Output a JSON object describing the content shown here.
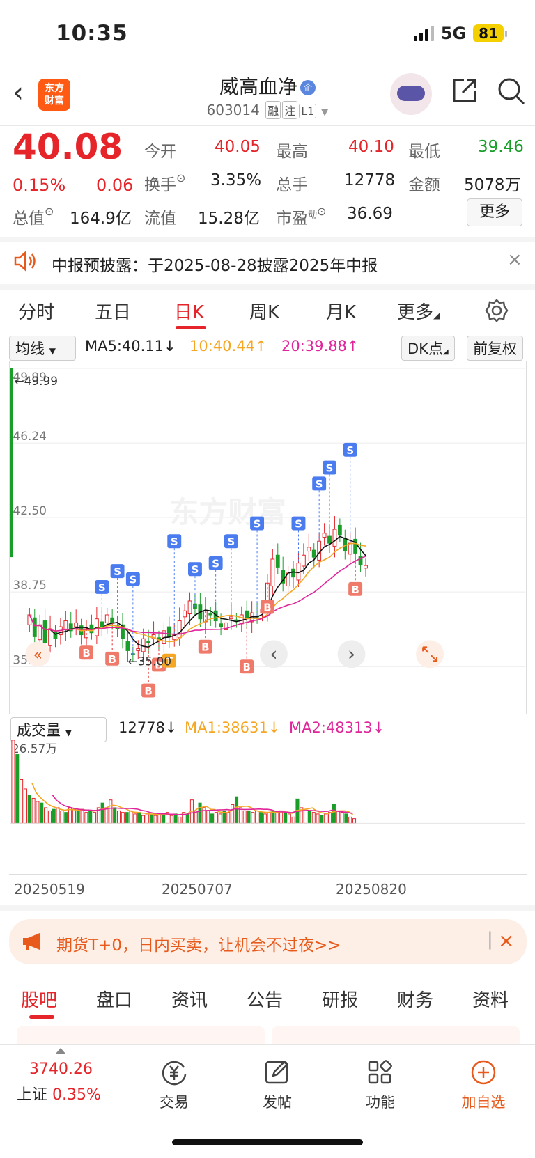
{
  "status": {
    "time": "10:35",
    "network": "5G",
    "battery": "81"
  },
  "header": {
    "logo_line1": "东方",
    "logo_line2": "财富",
    "stock_name": "威高血净",
    "name_badge": "企",
    "stock_code": "603014",
    "tags": [
      "融",
      "注",
      "L1"
    ]
  },
  "quote": {
    "price": "40.08",
    "change_pct": "0.15%",
    "change_amt": "0.06",
    "open_label": "今开",
    "open_value": "40.05",
    "high_label": "最高",
    "high_value": "40.10",
    "low_label": "最低",
    "low_value": "39.46",
    "turnover_label": "换手",
    "turnover_value": "3.35%",
    "total_hands_label": "总手",
    "total_hands_value": "12778",
    "amount_label": "金额",
    "amount_value": "5078万",
    "mktcap_label": "总值",
    "mktcap_value": "164.9亿",
    "float_label": "流值",
    "float_value": "15.28亿",
    "pe_label": "市盈",
    "pe_sup": "动",
    "pe_value": "36.69",
    "more_label": "更多"
  },
  "notice": {
    "text": "中报预披露：于2025-08-28披露2025年中报"
  },
  "chart_tabs": [
    "分时",
    "五日",
    "日K",
    "周K",
    "月K",
    "更多"
  ],
  "active_chart_tab": "日K",
  "ma_row": {
    "indicator": "均线",
    "ma5": "MA5:40.11↓",
    "ma10": "10:40.44↑",
    "ma20": "20:39.88↑",
    "dk_label": "DK点",
    "adjust_label": "前复权"
  },
  "chart_data": {
    "type": "candlestick",
    "y_ticks": [
      "49.99",
      "46.24",
      "42.50",
      "38.75",
      "35.00"
    ],
    "ylim": [
      35.0,
      49.99
    ],
    "max_marker": "49.99",
    "min_marker": "35.00",
    "watermark": "东方财富",
    "signals": [
      "S",
      "B",
      "T"
    ],
    "closes": [
      37.6,
      36.5,
      37.1,
      36.2,
      36.9,
      36.4,
      37.0,
      37.3,
      36.8,
      37.2,
      36.6,
      36.9,
      36.7,
      37.4,
      37.0,
      37.6,
      37.2,
      36.9,
      36.4,
      35.8,
      35.6,
      35.9,
      36.4,
      36.2,
      36.6,
      36.3,
      36.8,
      36.5,
      36.6,
      37.3,
      37.8,
      38.3,
      37.9,
      37.4,
      37.8,
      37.6,
      37.3,
      37.0,
      37.2,
      37.5,
      37.3,
      37.6,
      37.4,
      37.7,
      37.5,
      37.9,
      39.2,
      40.4,
      40.0,
      39.2,
      39.7,
      39.5,
      40.2,
      40.6,
      41.0,
      40.5,
      41.3,
      41.7,
      41.2,
      41.9,
      41.6,
      40.8,
      41.2,
      40.7,
      40.1,
      40.08
    ],
    "volume_label": "成交量",
    "volume_value": "12778↓",
    "vol_ma1": "MA1:38631↓",
    "vol_ma2": "MA2:48313↓",
    "volume_max": "26.57万",
    "volumes": [
      26.6,
      22,
      14,
      11,
      9,
      8,
      7,
      6.5,
      5,
      4,
      4.5,
      5,
      4,
      3.5,
      5,
      4.5,
      4,
      4.5,
      3.5,
      4,
      3.5,
      5,
      6.5,
      5,
      7.5,
      5,
      4,
      3.5,
      3.5,
      4,
      3,
      3.5,
      2.5,
      3,
      3,
      2.5,
      3,
      2.5,
      3.5,
      2.5,
      3,
      2,
      3.5,
      3,
      7.5,
      4,
      6.5,
      5,
      4,
      3,
      3.5,
      3,
      4,
      3.5,
      6,
      8.5,
      5,
      4,
      4,
      3.5,
      4,
      3.5,
      3,
      3.5,
      4,
      3.5,
      4,
      3.5,
      3,
      2,
      7.8,
      5,
      4.5,
      4,
      3.5,
      3,
      2.5,
      3,
      3.5,
      6,
      4,
      3.5,
      3,
      2,
      1.5
    ],
    "dates": [
      "20250519",
      "20250707",
      "20250820"
    ]
  },
  "promo": {
    "text": "期货T+0，日内买卖，让机会不过夜>>"
  },
  "bottom_tabs": [
    "股吧",
    "盘口",
    "资讯",
    "公告",
    "研报",
    "财务",
    "资料"
  ],
  "navbar": {
    "index_value": "3740.26",
    "index_name": "上证",
    "index_pct": "0.35%",
    "items": [
      "交易",
      "发帖",
      "功能",
      "加自选"
    ]
  },
  "colors": {
    "up": "#e5252a",
    "down": "#1a9e2a",
    "ma5": "#111111",
    "ma10": "#f5a623",
    "ma20": "#e0249a"
  }
}
